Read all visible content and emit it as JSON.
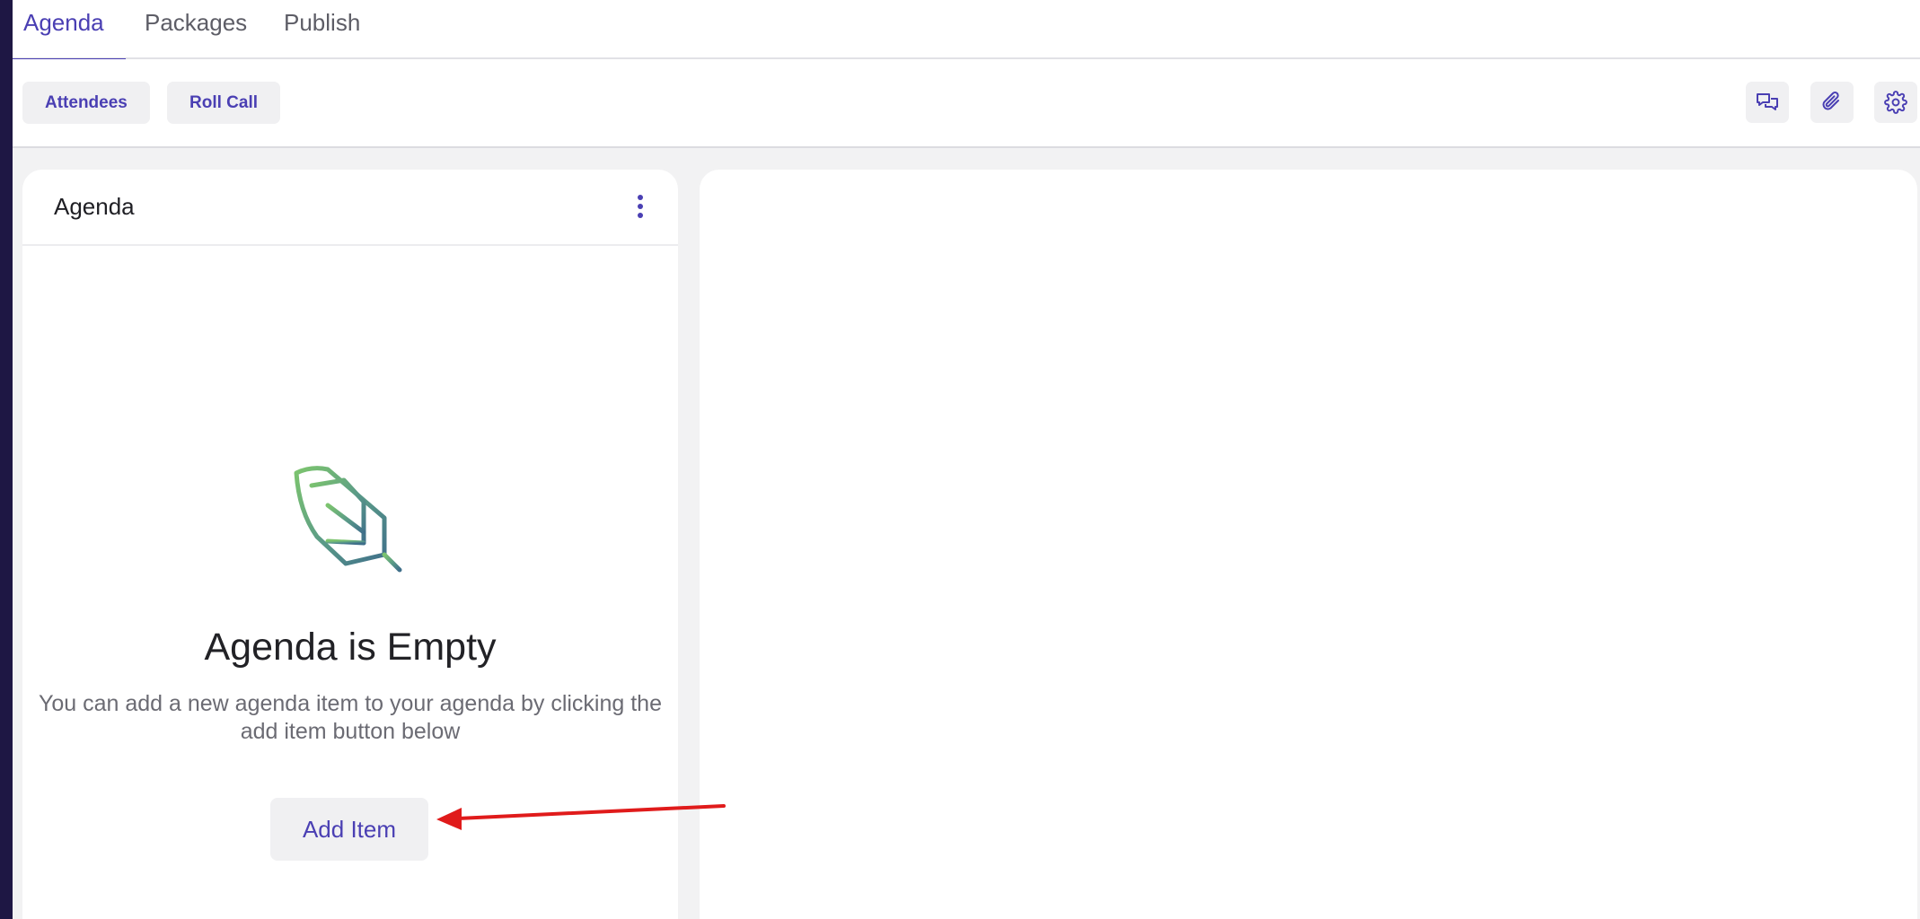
{
  "tabs": [
    {
      "label": "Agenda",
      "active": true
    },
    {
      "label": "Packages",
      "active": false
    },
    {
      "label": "Publish",
      "active": false
    }
  ],
  "toolbar": {
    "attendees_label": "Attendees",
    "rollcall_label": "Roll Call",
    "icons": [
      "comments-icon",
      "paperclip-icon",
      "gear-icon"
    ]
  },
  "agenda_panel": {
    "title": "Agenda",
    "empty_title": "Agenda is Empty",
    "empty_desc_line1": "You can add a new agenda item to your agenda by clicking the",
    "empty_desc_line2": "add item button below",
    "add_item_label": "Add Item"
  },
  "colors": {
    "accent": "#4a3fb3",
    "annotation_arrow": "#e01b1b",
    "left_edge": "#1e1744"
  }
}
